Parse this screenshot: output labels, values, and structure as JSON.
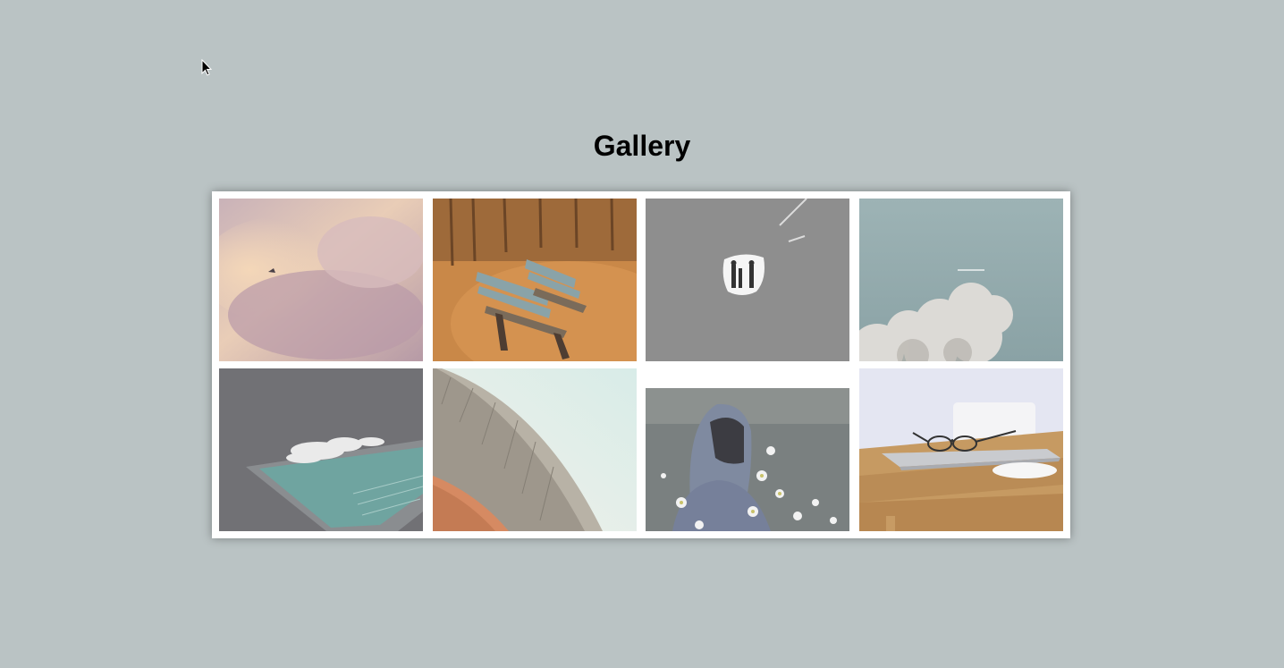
{
  "page": {
    "title": "Gallery",
    "background_color": "#bac3c4"
  },
  "gallery": {
    "images": [
      {
        "name": "sky-clouds-bird",
        "description_icon": "image-icon"
      },
      {
        "name": "autumn-park-benches",
        "description_icon": "image-icon"
      },
      {
        "name": "tunnel-silhouettes",
        "description_icon": "image-icon"
      },
      {
        "name": "blue-sky-clouds",
        "description_icon": "image-icon"
      },
      {
        "name": "ocean-pool-waves",
        "description_icon": "image-icon"
      },
      {
        "name": "building-curve",
        "description_icon": "image-icon"
      },
      {
        "name": "hooded-person-daisies",
        "description_icon": "image-icon"
      },
      {
        "name": "desk-glasses-mouse",
        "description_icon": "image-icon"
      }
    ]
  }
}
